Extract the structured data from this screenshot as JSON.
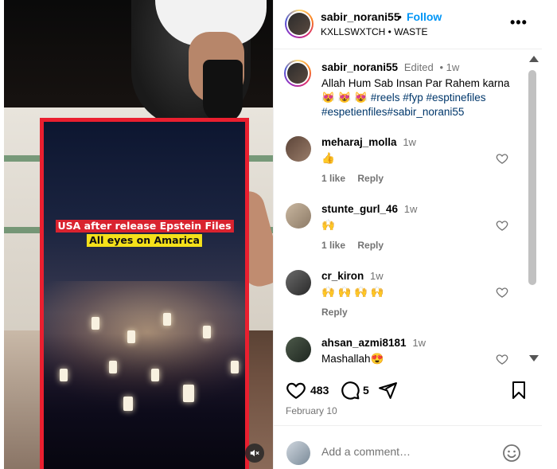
{
  "post": {
    "username": "sabir_norani55",
    "follow_label": "Follow",
    "separator": "•",
    "audio": "KXLLSWXTCH • WASTE",
    "more_label": "•••"
  },
  "video": {
    "overlay_line1": "USA after release Epstein Files",
    "overlay_line2": "All eyes on Amarica"
  },
  "caption": {
    "username": "sabir_norani55",
    "edited": "Edited",
    "time": "• 1w",
    "text_line1": "Allah Hum Sab Insan Par Rahem karna",
    "emojis": "😻 😻 😻",
    "hashtags_line1": "#reels #fyp #esptinefiles",
    "hashtags_line2": "#espetienfiles#sabir_norani55"
  },
  "comments": [
    {
      "username": "meharaj_molla",
      "time": "1w",
      "text": "👍",
      "likes": "1 like",
      "reply": "Reply"
    },
    {
      "username": "stunte_gurl_46",
      "time": "1w",
      "text": "🙌",
      "likes": "1 like",
      "reply": "Reply"
    },
    {
      "username": "cr_kiron",
      "time": "1w",
      "text": "🙌 🙌 🙌 🙌",
      "likes": "",
      "reply": "Reply"
    },
    {
      "username": "ahsan_azmi8181",
      "time": "1w",
      "text": "Mashallah😍",
      "likes": "",
      "reply": ""
    }
  ],
  "actions": {
    "likes_count": "483",
    "comments_count": "5",
    "date": "February 10"
  },
  "add_comment": {
    "placeholder": "Add a comment…"
  }
}
